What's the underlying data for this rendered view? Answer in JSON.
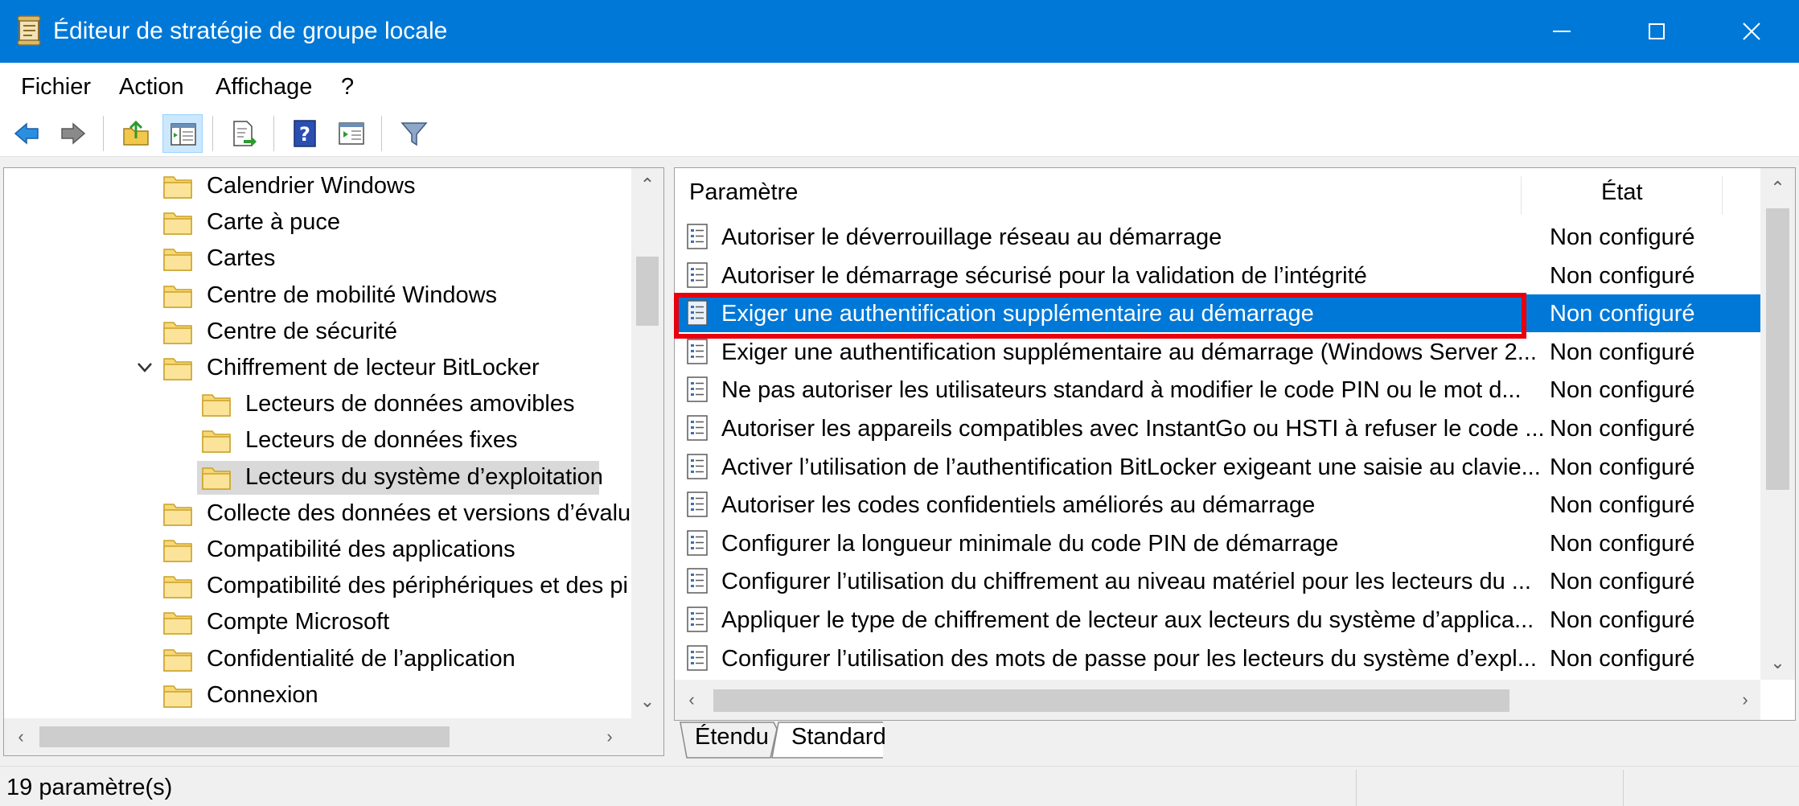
{
  "window": {
    "title": "Éditeur de stratégie de groupe locale"
  },
  "menu": {
    "items": [
      "Fichier",
      "Action",
      "Affichage",
      "?"
    ]
  },
  "tree": {
    "items": [
      "Calendrier Windows",
      "Carte à puce",
      "Cartes",
      "Centre de mobilité Windows",
      "Centre de sécurité",
      "Chiffrement de lecteur BitLocker",
      "Lecteurs de données amovibles",
      "Lecteurs de données fixes",
      "Lecteurs du système d’exploitation",
      "Collecte des données et versions d’évaluat",
      "Compatibilité des applications",
      "Compatibilité des périphériques et des pi",
      "Compte Microsoft",
      "Confidentialité de l’application",
      "Connexion"
    ],
    "selected_index": 8,
    "expanded_index": 5
  },
  "list": {
    "header": {
      "parametre": "Paramètre",
      "etat": "État"
    },
    "rows": [
      {
        "name": "Autoriser le déverrouillage réseau au démarrage",
        "state": "Non configuré"
      },
      {
        "name": "Autoriser le démarrage sécurisé pour la validation de l’intégrité",
        "state": "Non configuré"
      },
      {
        "name": "Exiger une authentification supplémentaire au démarrage",
        "state": "Non configuré"
      },
      {
        "name": "Exiger une authentification supplémentaire au démarrage (Windows Server 2...",
        "state": "Non configuré"
      },
      {
        "name": "Ne pas autoriser les utilisateurs standard à modifier le code PIN ou le mot d...",
        "state": "Non configuré"
      },
      {
        "name": "Autoriser les appareils compatibles avec InstantGo ou HSTI à refuser le code ...",
        "state": "Non configuré"
      },
      {
        "name": "Activer l’utilisation de l’authentification BitLocker exigeant une saisie au clavie...",
        "state": "Non configuré"
      },
      {
        "name": "Autoriser les codes confidentiels améliorés au démarrage",
        "state": "Non configuré"
      },
      {
        "name": "Configurer la longueur minimale du code PIN de démarrage",
        "state": "Non configuré"
      },
      {
        "name": "Configurer l’utilisation du chiffrement au niveau matériel pour les lecteurs du ...",
        "state": "Non configuré"
      },
      {
        "name": "Appliquer le type de chiffrement de lecteur aux lecteurs du système d’applica...",
        "state": "Non configuré"
      },
      {
        "name": "Configurer l’utilisation des mots de passe pour les lecteurs du système d’expl...",
        "state": "Non configuré"
      }
    ],
    "selected_index": 2
  },
  "tabs": [
    "Étendu",
    "Standard"
  ],
  "status": {
    "text": "19 paramètre(s)"
  },
  "colors": {
    "accent": "#0078d7",
    "highlight_border": "#e8000d",
    "folder": "#f8d775"
  }
}
